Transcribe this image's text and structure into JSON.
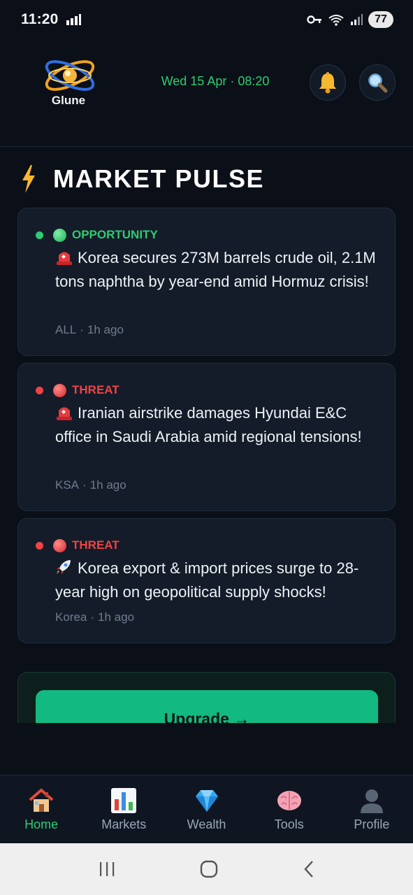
{
  "status_bar": {
    "time": "11:20",
    "battery": "77"
  },
  "header": {
    "logo_text": "Glune",
    "datetime": "Wed 15 Apr · 08:20",
    "icons": [
      "bell-icon",
      "search-icon"
    ]
  },
  "section": {
    "title": "MARKET PULSE",
    "icon": "lightning-icon"
  },
  "cards": [
    {
      "tag": "OPPORTUNITY",
      "tag_color": "#2ecc71",
      "emoji": "siren-icon",
      "text": "Korea secures 273M barrels crude oil, 2.1M tons naphtha by year-end amid Hormuz crisis!",
      "region": "ALL",
      "time": "1h ago"
    },
    {
      "tag": "THREAT",
      "tag_color": "#ef4444",
      "emoji": "siren-icon",
      "text": "Iranian airstrike damages Hyundai E&C office in Saudi Arabia amid regional tensions!",
      "region": "KSA",
      "time": "1h ago"
    },
    {
      "tag": "THREAT",
      "tag_color": "#ef4444",
      "emoji": "rocket-icon",
      "text": "Korea export & import prices surge to 28-year high on geopolitical supply shocks!",
      "region": "Korea",
      "time": "1h ago"
    }
  ],
  "upgrade": {
    "label": "Upgrade →"
  },
  "nav": {
    "items": [
      {
        "label": "Home",
        "icon": "house-icon",
        "active": true
      },
      {
        "label": "Markets",
        "icon": "bar-chart-icon",
        "active": false
      },
      {
        "label": "Wealth",
        "icon": "gem-icon",
        "active": false
      },
      {
        "label": "Tools",
        "icon": "brain-icon",
        "active": false
      },
      {
        "label": "Profile",
        "icon": "user-icon",
        "active": false
      }
    ]
  },
  "colors": {
    "background": "#0b0f17",
    "card": "#141c29",
    "accent_green": "#2ecc71",
    "threat_red": "#ef4444",
    "upgrade_green": "#12b981"
  }
}
